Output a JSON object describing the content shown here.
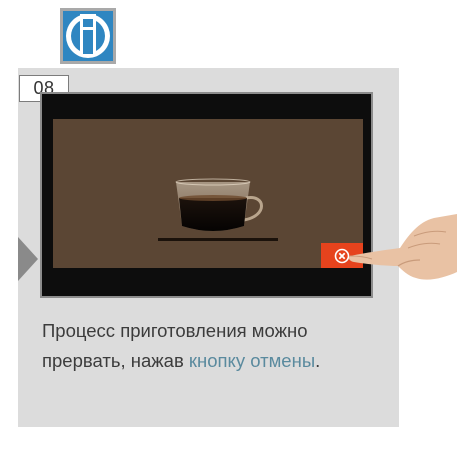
{
  "step": {
    "number": "08"
  },
  "info": {
    "icon": "info-icon",
    "color": "#2f86c1"
  },
  "screen": {
    "background_color": "#5b4634",
    "cancel_button_color": "#e6431d",
    "cancel_icon": "cancel-x-icon"
  },
  "description": {
    "text_before": "Процесс приготовления можно прервать, нажав ",
    "link_text_1": "кнопку",
    "text_between": " ",
    "link_text_2": "отмены",
    "text_after": "."
  },
  "colors": {
    "card_background": "#dcdcdc",
    "link": "#5a8a9e",
    "text": "#3c3c3c"
  }
}
